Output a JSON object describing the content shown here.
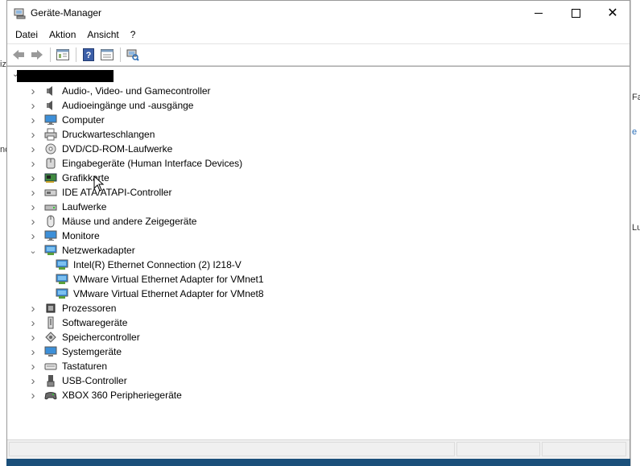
{
  "window": {
    "title": "Geräte-Manager"
  },
  "menu": [
    "Datei",
    "Aktion",
    "Ansicht",
    "?"
  ],
  "toolbar": [
    "back-icon",
    "forward-icon",
    "properties-view-icon",
    "help-icon",
    "show-hidden-icon",
    "scan-hardware-icon"
  ],
  "tree": {
    "categories": [
      {
        "label": "Audio-, Video- und Gamecontroller",
        "icon": "speaker-icon",
        "expanded": false
      },
      {
        "label": "Audioeingänge und -ausgänge",
        "icon": "speaker-icon",
        "expanded": false
      },
      {
        "label": "Computer",
        "icon": "monitor-icon",
        "expanded": false
      },
      {
        "label": "Druckwarteschlangen",
        "icon": "printer-icon",
        "expanded": false
      },
      {
        "label": "DVD/CD-ROM-Laufwerke",
        "icon": "disc-drive-icon",
        "expanded": false
      },
      {
        "label": "Eingabegeräte (Human Interface Devices)",
        "icon": "hid-icon",
        "expanded": false
      },
      {
        "label": "Grafikkarte",
        "icon": "graphics-card-icon",
        "expanded": false
      },
      {
        "label": "IDE ATA/ATAPI-Controller",
        "icon": "ide-controller-icon",
        "expanded": false
      },
      {
        "label": "Laufwerke",
        "icon": "disk-drive-icon",
        "expanded": false
      },
      {
        "label": "Mäuse und andere Zeigegeräte",
        "icon": "mouse-icon",
        "expanded": false
      },
      {
        "label": "Monitore",
        "icon": "monitor-icon",
        "expanded": false
      },
      {
        "label": "Netzwerkadapter",
        "icon": "network-adapter-icon",
        "expanded": true,
        "children": [
          {
            "label": "Intel(R) Ethernet Connection (2) I218-V",
            "icon": "network-adapter-icon"
          },
          {
            "label": "VMware Virtual Ethernet Adapter for VMnet1",
            "icon": "network-adapter-icon"
          },
          {
            "label": "VMware Virtual Ethernet Adapter for VMnet8",
            "icon": "network-adapter-icon"
          }
        ]
      },
      {
        "label": "Prozessoren",
        "icon": "cpu-icon",
        "expanded": false
      },
      {
        "label": "Softwaregeräte",
        "icon": "software-device-icon",
        "expanded": false
      },
      {
        "label": "Speichercontroller",
        "icon": "storage-controller-icon",
        "expanded": false
      },
      {
        "label": "Systemgeräte",
        "icon": "system-device-icon",
        "expanded": false
      },
      {
        "label": "Tastaturen",
        "icon": "keyboard-icon",
        "expanded": false
      },
      {
        "label": "USB-Controller",
        "icon": "usb-icon",
        "expanded": false
      },
      {
        "label": "XBOX 360 Peripheriegeräte",
        "icon": "gamepad-icon",
        "expanded": false
      }
    ]
  },
  "colors": {
    "accent": "#2a6eb8",
    "expander": "#6d6d6d",
    "desktop": "#1a4f7a"
  }
}
